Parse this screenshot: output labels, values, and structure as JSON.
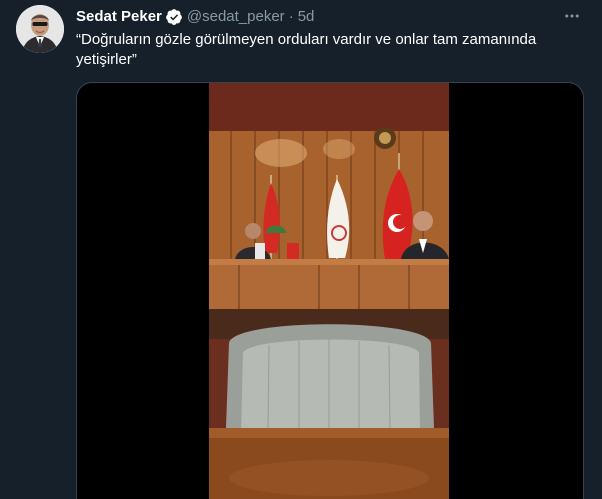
{
  "tweet": {
    "author_name": "Sedat Peker",
    "handle": "@sedat_peker",
    "separator": "·",
    "time": "5d",
    "text": "“Doğruların gözle görülmeyen orduları vardır ve onlar tam zamanında\nyetişirler”",
    "verified": true
  },
  "icons": {
    "verified": "verified-badge-icon",
    "more": "more-dots-icon"
  },
  "media": {
    "type": "video",
    "description_icon": "video-thumbnail"
  },
  "colors": {
    "background": "#15202b",
    "text_primary": "#ffffff",
    "text_secondary": "#8899a6",
    "accent": "#1da1f2",
    "border": "#38444d"
  }
}
